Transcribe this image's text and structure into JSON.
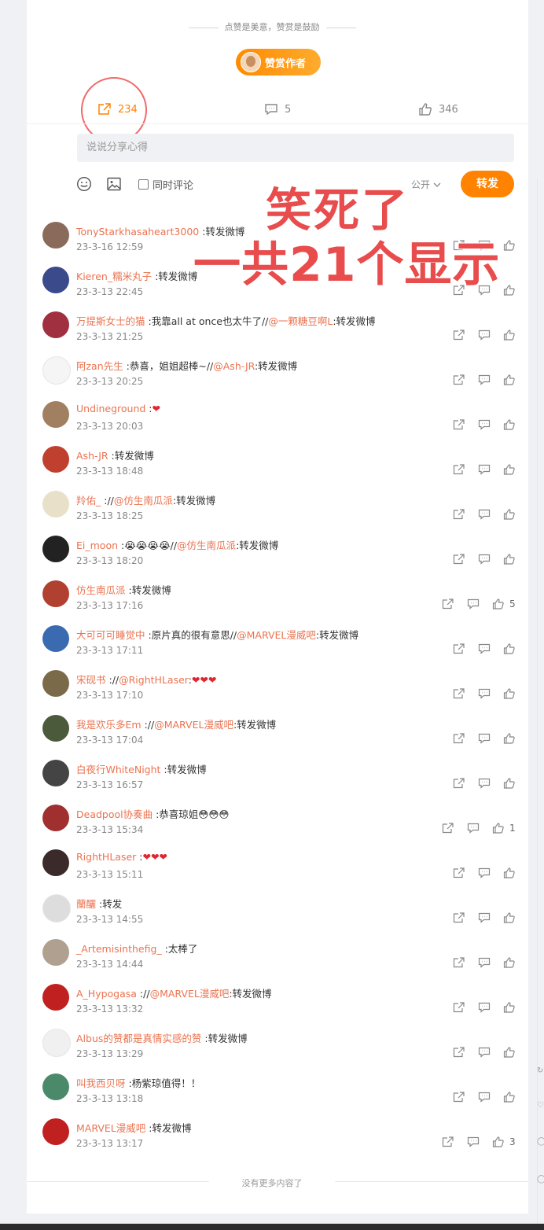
{
  "motto": "点赞是美意，赞赏是鼓励",
  "reward_label": "赞赏作者",
  "actions": {
    "forward_count": "234",
    "comment_count": "5",
    "like_count": "346"
  },
  "share_placeholder": "说说分享心得",
  "tools": {
    "also_comment": "同时评论",
    "visibility": "公开",
    "post": "转发"
  },
  "annotation": {
    "line1": "笑死了",
    "line2": "一共21个显示"
  },
  "list_end": "没有更多内容了",
  "colors": {
    "accent": "#ff8200",
    "link": "#eb7350",
    "annotation": "#e84c4c"
  },
  "reposts": [
    {
      "name": "TonyStarkhasaheart3000",
      "text": ":转发微博",
      "time": "23-3-16 12:59",
      "like_count": ""
    },
    {
      "name": "Kieren_糯米丸子",
      "text": ":转发微博",
      "time": "23-3-13 22:45",
      "like_count": ""
    },
    {
      "name": "万提斯女士的猫",
      "text": ":我靠all at once也太牛了//",
      "mention": "@一颗糖豆啊L",
      "text2": ":转发微博",
      "time": "23-3-13 21:25",
      "like_count": ""
    },
    {
      "name": "阿zan先生",
      "text": ":恭喜，姐姐超棒~//",
      "mention": "@Ash-JR",
      "text2": ":转发微博",
      "time": "23-3-13 20:25",
      "like_count": ""
    },
    {
      "name": "Undineground",
      "text": ":",
      "hearts": "❤",
      "time": "23-3-13 20:03",
      "like_count": ""
    },
    {
      "name": "Ash-JR",
      "text": ":转发微博",
      "time": "23-3-13 18:48",
      "like_count": ""
    },
    {
      "name": "羚佑_",
      "text": "://",
      "mention": "@仿生南瓜派",
      "text2": ":转发微博",
      "time": "23-3-13 18:25",
      "like_count": ""
    },
    {
      "name": "Ei_moon",
      "text": ":😭😭😭😭//",
      "mention": "@仿生南瓜派",
      "text2": ":转发微博",
      "time": "23-3-13 18:20",
      "like_count": ""
    },
    {
      "name": "仿生南瓜派",
      "text": ":转发微博",
      "time": "23-3-13 17:16",
      "like_count": "5"
    },
    {
      "name": "大可可可睡觉中",
      "text": ":原片真的很有意思//",
      "mention": "@MARVEL漫威吧",
      "text2": ":转发微博",
      "time": "23-3-13 17:11",
      "like_count": ""
    },
    {
      "name": "宋砚书",
      "text": "://",
      "mention": "@RightHLaser",
      "text2": ":",
      "hearts": "❤❤❤",
      "time": "23-3-13 17:10",
      "like_count": ""
    },
    {
      "name": "我是欢乐多Em",
      "text": "://",
      "mention": "@MARVEL漫威吧",
      "text2": ":转发微博",
      "time": "23-3-13 17:04",
      "like_count": ""
    },
    {
      "name": "白夜行WhiteNight",
      "text": ":转发微博",
      "time": "23-3-13 16:57",
      "like_count": ""
    },
    {
      "name": "Deadpool协奏曲",
      "text": ":恭喜琼姐😳😳😳",
      "time": "23-3-13 15:34",
      "like_count": "1"
    },
    {
      "name": "RightHLaser",
      "text": ":",
      "hearts": "❤❤❤",
      "time": "23-3-13 15:11",
      "like_count": ""
    },
    {
      "name": "蘭釃",
      "text": ":转发",
      "time": "23-3-13 14:55",
      "like_count": ""
    },
    {
      "name": "_Artemisinthefig_",
      "text": ":太棒了",
      "time": "23-3-13 14:44",
      "like_count": ""
    },
    {
      "name": "A_Hypogasa",
      "text": "://",
      "mention": "@MARVEL漫威吧",
      "text2": ":转发微博",
      "time": "23-3-13 13:32",
      "like_count": ""
    },
    {
      "name": "Albus的赞都是真情实感的赞",
      "text": ":转发微博",
      "time": "23-3-13 13:29",
      "like_count": ""
    },
    {
      "name": "叫我西贝呀",
      "text": ":杨紫琼值得！！",
      "time": "23-3-13 13:18",
      "like_count": ""
    },
    {
      "name": "MARVEL漫威吧",
      "text": ":转发微博",
      "time": "23-3-13 13:17",
      "like_count": "3"
    }
  ]
}
